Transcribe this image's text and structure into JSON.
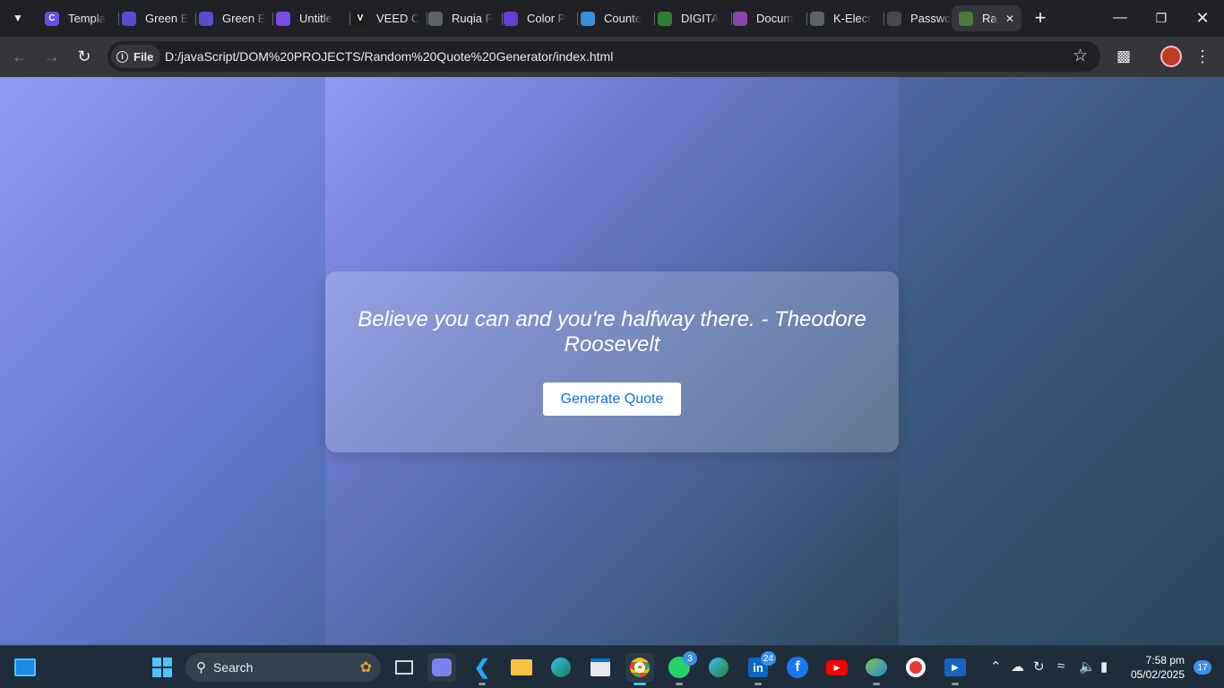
{
  "browser": {
    "tabs": [
      {
        "label": "Templa",
        "color": "#6b4ce6",
        "glyph": "C"
      },
      {
        "label": "Green E",
        "color": "#5a4bd1",
        "glyph": ""
      },
      {
        "label": "Green E",
        "color": "#5a4bd1",
        "glyph": ""
      },
      {
        "label": "Untitle",
        "color": "#7b4ce6",
        "glyph": ""
      },
      {
        "label": "VEED C",
        "color": "#1c1c1c",
        "glyph": "V"
      },
      {
        "label": "Ruqia F",
        "color": "#5f6368",
        "glyph": ""
      },
      {
        "label": "Color P",
        "color": "#6c3ad6",
        "glyph": ""
      },
      {
        "label": "Counte",
        "color": "#3a8fd6",
        "glyph": ""
      },
      {
        "label": "DIGITA",
        "color": "#2e7d32",
        "glyph": ""
      },
      {
        "label": "Docum",
        "color": "#8e44ad",
        "glyph": ""
      },
      {
        "label": "K-Elect",
        "color": "#5f6368",
        "glyph": ""
      },
      {
        "label": "Passwo",
        "color": "#4a4a4a",
        "glyph": ""
      },
      {
        "label": "Ra",
        "color": "#4e7a3a",
        "glyph": ""
      }
    ],
    "new_tab": "+",
    "url_chip": "File",
    "url": "D:/javaScript/DOM%20PROJECTS/Random%20Quote%20Generator/index.html"
  },
  "page": {
    "quote": "Believe you can and you're halfway there. - Theodore Roosevelt",
    "button_label": "Generate Quote"
  },
  "taskbar": {
    "search_label": "Search",
    "whatsapp_badge": "3",
    "linkedin_badge": "24",
    "time": "7:58 pm",
    "date": "05/02/2025",
    "notifications": "17"
  }
}
